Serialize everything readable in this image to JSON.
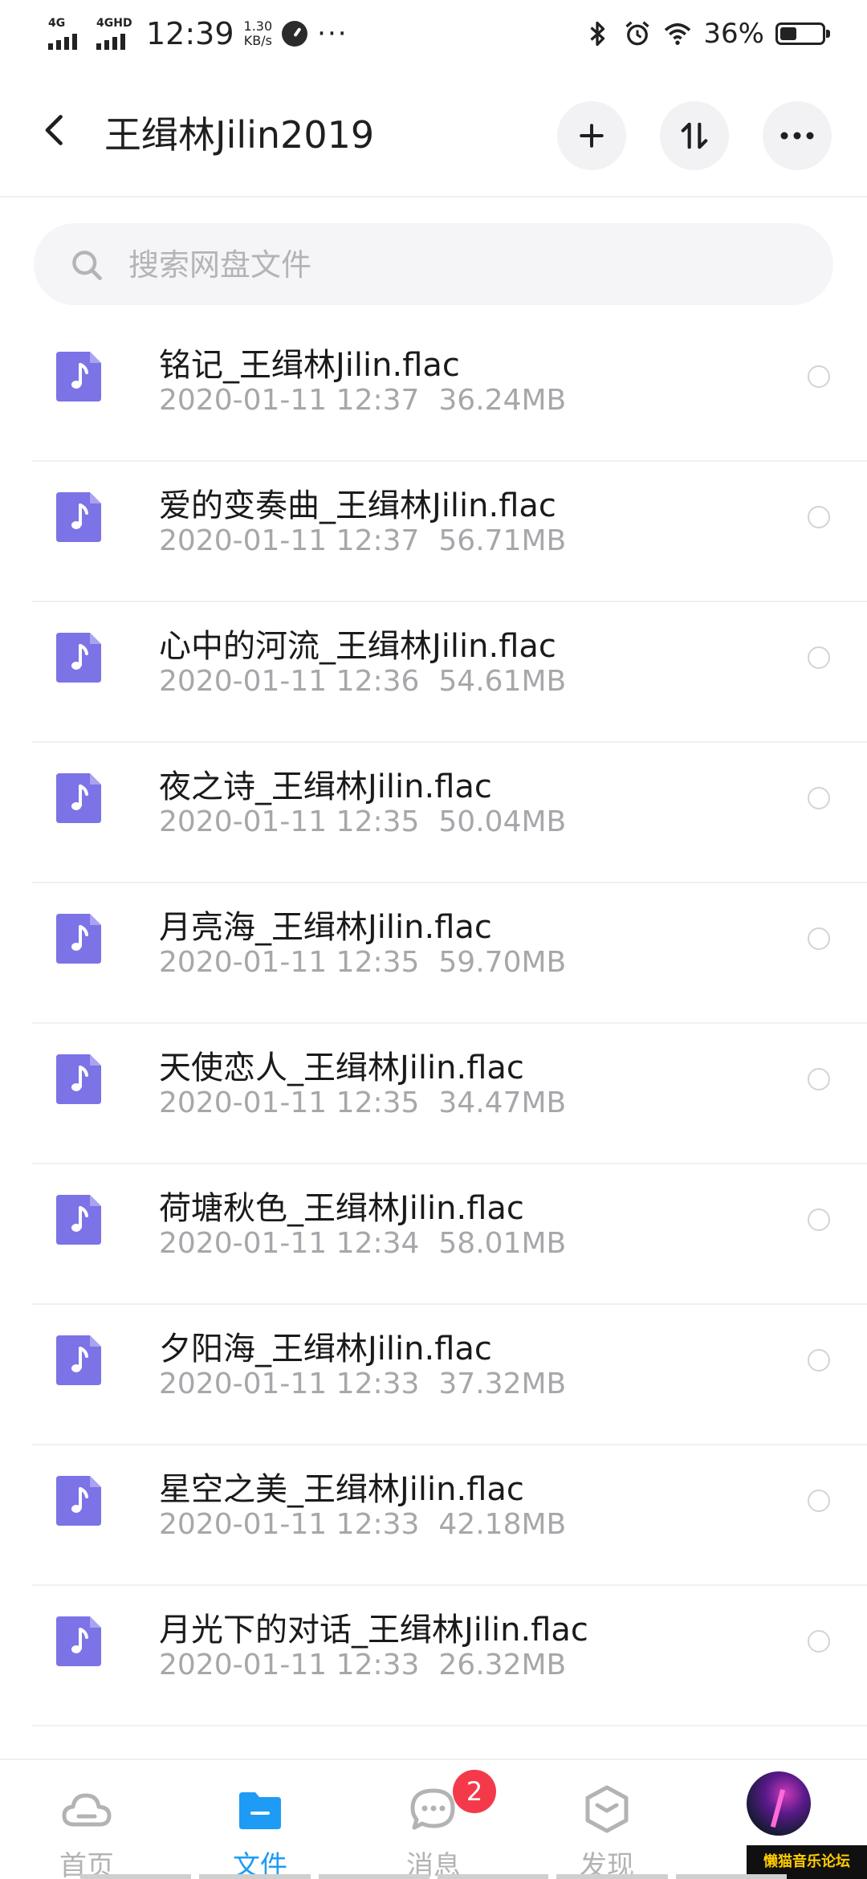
{
  "status_bar": {
    "network_1": "4G",
    "network_2": "4GHD",
    "time": "12:39",
    "speed_value": "1.30",
    "speed_unit": "KB/s",
    "more": "···",
    "battery_percent": "36%",
    "battery_level": 0.36
  },
  "header": {
    "title": "王缉林Jilin2019",
    "back_icon": "chevron-left-icon",
    "add_icon": "plus-icon",
    "sort_icon": "sort-arrows-icon",
    "more_icon": "more-dots-icon"
  },
  "search": {
    "placeholder": "搜索网盘文件",
    "value": ""
  },
  "files": [
    {
      "name": "铭记_王缉林Jilin.flac",
      "date": "2020-01-11  12:37",
      "size": "36.24MB"
    },
    {
      "name": "爱的变奏曲_王缉林Jilin.flac",
      "date": "2020-01-11  12:37",
      "size": "56.71MB"
    },
    {
      "name": "心中的河流_王缉林Jilin.flac",
      "date": "2020-01-11  12:36",
      "size": "54.61MB"
    },
    {
      "name": "夜之诗_王缉林Jilin.flac",
      "date": "2020-01-11  12:35",
      "size": "50.04MB"
    },
    {
      "name": "月亮海_王缉林Jilin.flac",
      "date": "2020-01-11  12:35",
      "size": "59.70MB"
    },
    {
      "name": "天使恋人_王缉林Jilin.flac",
      "date": "2020-01-11  12:35",
      "size": "34.47MB"
    },
    {
      "name": "荷塘秋色_王缉林Jilin.flac",
      "date": "2020-01-11  12:34",
      "size": "58.01MB"
    },
    {
      "name": "夕阳海_王缉林Jilin.flac",
      "date": "2020-01-11  12:33",
      "size": "37.32MB"
    },
    {
      "name": "星空之美_王缉林Jilin.flac",
      "date": "2020-01-11  12:33",
      "size": "42.18MB"
    },
    {
      "name": "月光下的对话_王缉林Jilin.flac",
      "date": "2020-01-11  12:33",
      "size": "26.32MB"
    }
  ],
  "bottom_nav": {
    "home": "首页",
    "files": "文件",
    "messages": "消息",
    "messages_badge": "2",
    "discover": "发现",
    "active": "files"
  },
  "watermark": "懒猫音乐论坛",
  "colors": {
    "accent": "#1e9bf4",
    "file_icon": "#7b73e6",
    "badge": "#f43a4a",
    "meta_text": "#a7a7ab"
  }
}
